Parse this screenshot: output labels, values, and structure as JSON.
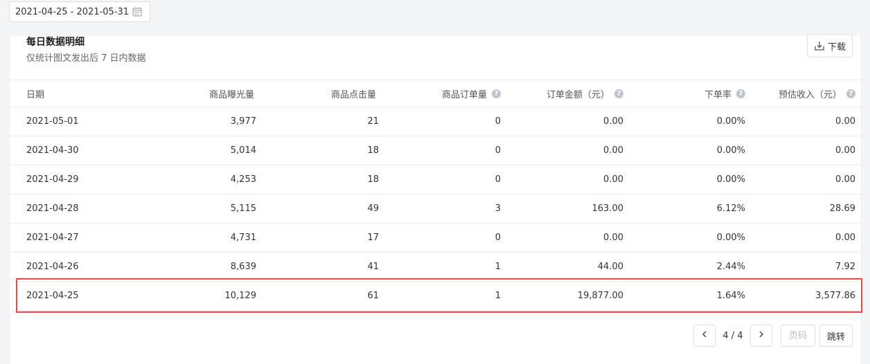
{
  "date_range": {
    "value": "2021-04-25 - 2021-05-31",
    "icon": "calendar-icon"
  },
  "card": {
    "title": "每日数据明细",
    "subtitle": "仅统计图文发出后 7 日内数据",
    "download_label": "下载"
  },
  "table": {
    "headers": [
      "日期",
      "商品曝光量",
      "商品点击量",
      "商品订单量",
      "订单金额（元）",
      "下单率",
      "预估收入（元）"
    ],
    "help_icon": "?",
    "rows": [
      [
        "2021-05-01",
        "3,977",
        "21",
        "0",
        "0.00",
        "0.00%",
        "0.00"
      ],
      [
        "2021-04-30",
        "5,014",
        "18",
        "0",
        "0.00",
        "0.00%",
        "0.00"
      ],
      [
        "2021-04-29",
        "4,253",
        "18",
        "0",
        "0.00",
        "0.00%",
        "0.00"
      ],
      [
        "2021-04-28",
        "5,115",
        "49",
        "3",
        "163.00",
        "6.12%",
        "28.69"
      ],
      [
        "2021-04-27",
        "4,731",
        "17",
        "0",
        "0.00",
        "0.00%",
        "0.00"
      ],
      [
        "2021-04-26",
        "8,639",
        "41",
        "1",
        "44.00",
        "2.44%",
        "7.92"
      ],
      [
        "2021-04-25",
        "10,129",
        "61",
        "1",
        "19,877.00",
        "1.64%",
        "3,577.86"
      ]
    ],
    "highlight_color": "#e84a4a"
  },
  "pagination": {
    "page_info": "4 / 4",
    "page_input_placeholder": "页码",
    "jump_label": "跳转"
  }
}
